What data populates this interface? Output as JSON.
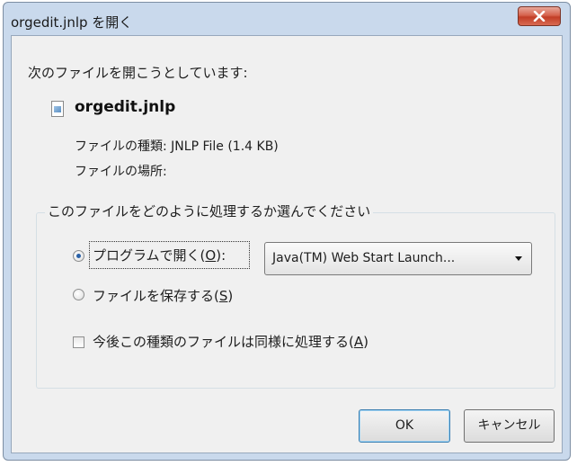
{
  "window": {
    "title": "orgedit.jnlp を開く"
  },
  "dialog": {
    "intro": "次のファイルを開こうとしています:",
    "file_name": "orgedit.jnlp",
    "type_label": "ファイルの種類:",
    "type_value": "JNLP File (1.4 KB)",
    "location_label": "ファイルの場所:",
    "group_label": "このファイルをどのように処理するか選んでください",
    "open_with": {
      "label": "プログラムで開く(",
      "accel": "O",
      "suffix": "):",
      "selected": true
    },
    "app_select": {
      "value": "Java(TM) Web Start Launch..."
    },
    "save_file": {
      "label": "ファイルを保存する(",
      "accel": "S",
      "suffix": ")",
      "selected": false
    },
    "always_do": {
      "label": "今後この種類のファイルは同様に処理する(",
      "accel": "A",
      "suffix": ")",
      "checked": false
    },
    "ok_label": "OK",
    "cancel_label": "キャンセル"
  },
  "icons": [
    "close-icon",
    "file-icon",
    "dropdown-arrow-icon"
  ]
}
